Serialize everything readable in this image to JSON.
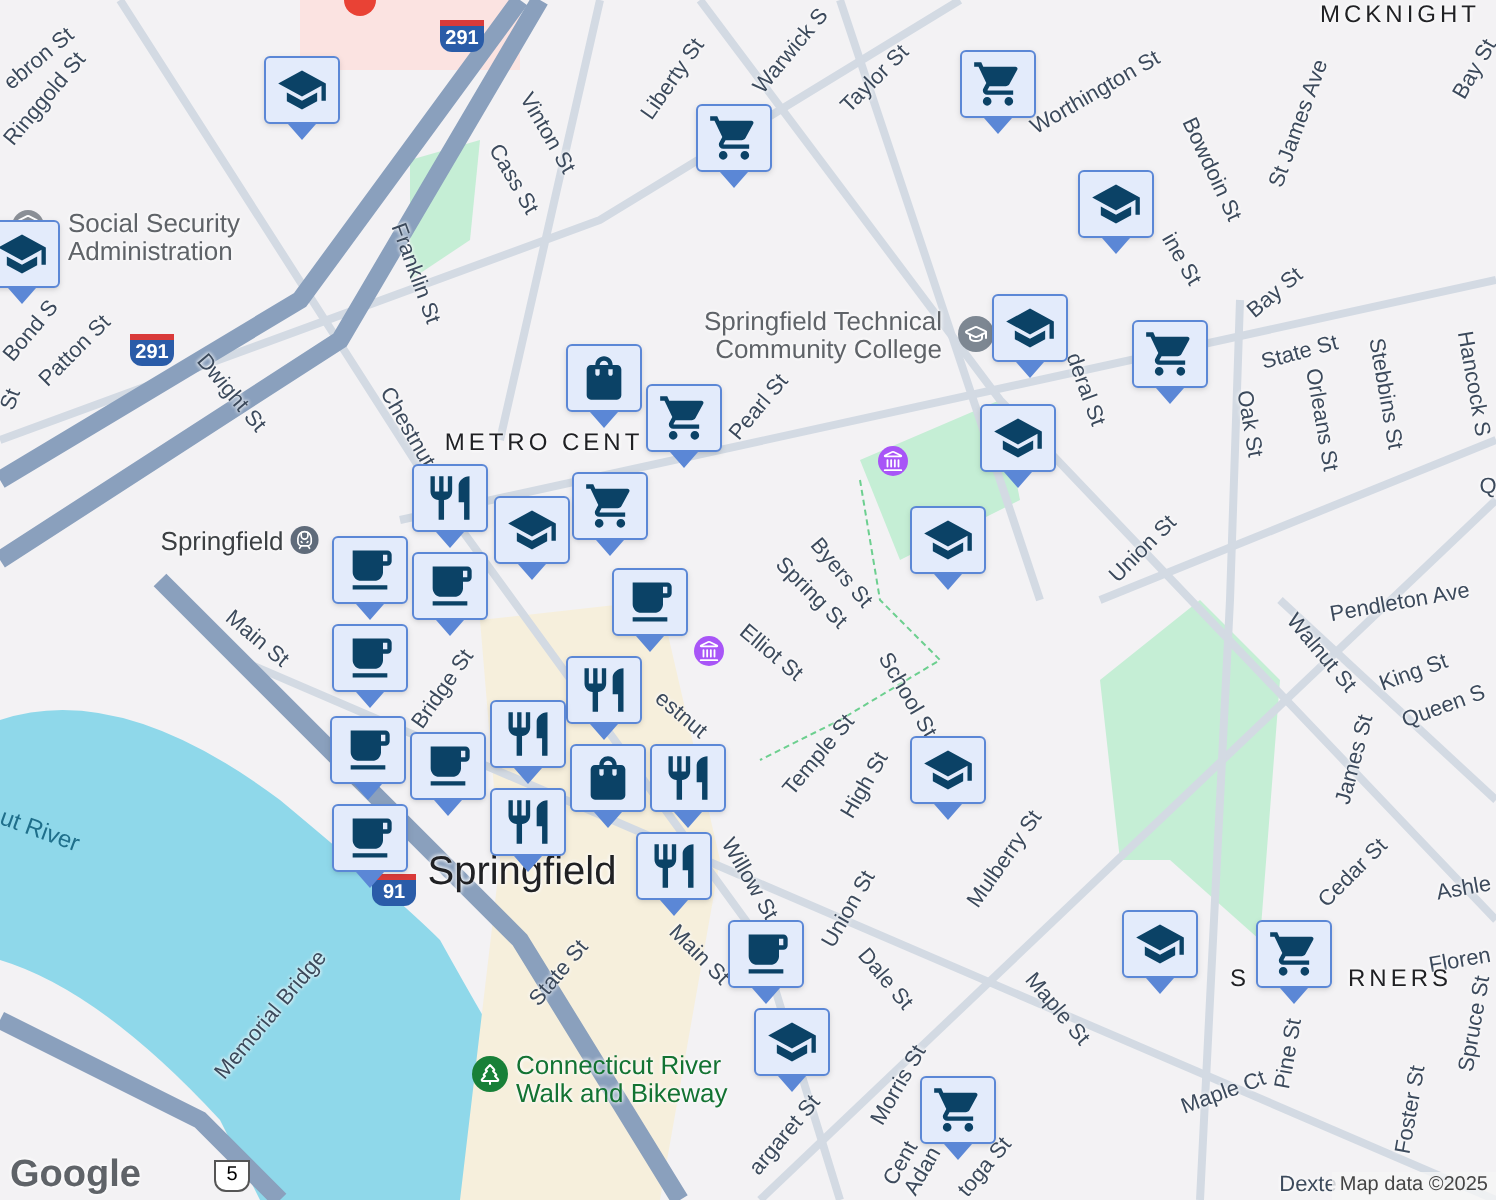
{
  "map": {
    "labels": [
      {
        "text": "ebron St",
        "kind": "street"
      },
      {
        "text": "Ringgold St",
        "kind": "street"
      },
      {
        "text": "Vinton St",
        "kind": "street"
      },
      {
        "text": "Cass St",
        "kind": "street"
      },
      {
        "text": "Franklin St",
        "kind": "street"
      },
      {
        "text": "Liberty St",
        "kind": "street"
      },
      {
        "text": "Social Security Administration",
        "kind": "poi"
      },
      {
        "text": "Bond S",
        "kind": "street"
      },
      {
        "text": "Patton St",
        "kind": "street"
      },
      {
        "text": "St",
        "kind": "street"
      },
      {
        "text": "Dwight St",
        "kind": "street"
      },
      {
        "text": "Chestnut",
        "kind": "street"
      },
      {
        "text": "METRO CENT",
        "kind": "district"
      },
      {
        "text": "Springfield",
        "kind": "transit"
      },
      {
        "text": "Warwick S",
        "kind": "street"
      },
      {
        "text": "Taylor St",
        "kind": "street"
      },
      {
        "text": "Worthington St",
        "kind": "street"
      },
      {
        "text": "Bowdoin St",
        "kind": "street"
      },
      {
        "text": "St James Ave",
        "kind": "street"
      },
      {
        "text": "MCKNIGHT",
        "kind": "district"
      },
      {
        "text": "Bay St",
        "kind": "street"
      },
      {
        "text": "Bay St",
        "kind": "street"
      },
      {
        "text": "ine St",
        "kind": "street"
      },
      {
        "text": "Springfield Technical Community College",
        "kind": "poi"
      },
      {
        "text": "Pearl St",
        "kind": "street"
      },
      {
        "text": "deral St",
        "kind": "street"
      },
      {
        "text": "State St",
        "kind": "street"
      },
      {
        "text": "Oak St",
        "kind": "street"
      },
      {
        "text": "Orleans St",
        "kind": "street"
      },
      {
        "text": "Stebbins St",
        "kind": "street"
      },
      {
        "text": "Hancock S",
        "kind": "street"
      },
      {
        "text": "Q",
        "kind": "street"
      },
      {
        "text": "Byers St",
        "kind": "street"
      },
      {
        "text": "Spring St",
        "kind": "street"
      },
      {
        "text": "Union St",
        "kind": "street"
      },
      {
        "text": "Pendleton Ave",
        "kind": "street"
      },
      {
        "text": "Walnut St",
        "kind": "street"
      },
      {
        "text": "King St",
        "kind": "street"
      },
      {
        "text": "Queen S",
        "kind": "street"
      },
      {
        "text": "Elliot St",
        "kind": "street"
      },
      {
        "text": "School St",
        "kind": "street"
      },
      {
        "text": "Temple St",
        "kind": "street"
      },
      {
        "text": "High St",
        "kind": "street"
      },
      {
        "text": "Mulberry St",
        "kind": "street"
      },
      {
        "text": "James St",
        "kind": "street"
      },
      {
        "text": "Cedar St",
        "kind": "street"
      },
      {
        "text": "Ashle",
        "kind": "street"
      },
      {
        "text": "Floren",
        "kind": "street"
      },
      {
        "text": "S",
        "kind": "district"
      },
      {
        "text": "RNERS",
        "kind": "district"
      },
      {
        "text": "Spruce St",
        "kind": "street"
      },
      {
        "text": "Pine St",
        "kind": "street"
      },
      {
        "text": "Foster St",
        "kind": "street"
      },
      {
        "text": "Maple Ct",
        "kind": "street"
      },
      {
        "text": "Maple St",
        "kind": "street"
      },
      {
        "text": "Dale St",
        "kind": "street"
      },
      {
        "text": "Union St",
        "kind": "street"
      },
      {
        "text": "Willow St",
        "kind": "street"
      },
      {
        "text": "Morris St",
        "kind": "street"
      },
      {
        "text": "Cent",
        "kind": "street"
      },
      {
        "text": "Adan",
        "kind": "street"
      },
      {
        "text": "toga St",
        "kind": "street"
      },
      {
        "text": "Dexte",
        "kind": "street"
      },
      {
        "text": "argaret St",
        "kind": "street"
      },
      {
        "text": "Main St",
        "kind": "street"
      },
      {
        "text": "Bridge St",
        "kind": "street"
      },
      {
        "text": "estnut",
        "kind": "street"
      },
      {
        "text": "Main St",
        "kind": "street"
      },
      {
        "text": "State St",
        "kind": "street"
      },
      {
        "text": "Springfield",
        "kind": "city"
      },
      {
        "text": "ut River",
        "kind": "water"
      },
      {
        "text": "Memorial Bridge",
        "kind": "street"
      },
      {
        "text": "Connecticut River Walk and Bikeway",
        "kind": "park"
      }
    ],
    "shields": [
      {
        "text": "291",
        "kind": "interstate"
      },
      {
        "text": "291",
        "kind": "interstate"
      },
      {
        "text": "91",
        "kind": "interstate"
      },
      {
        "text": "5",
        "kind": "us"
      }
    ],
    "markers": [
      {
        "kind": "school"
      },
      {
        "kind": "cart"
      },
      {
        "kind": "school"
      },
      {
        "kind": "cart"
      },
      {
        "kind": "school"
      },
      {
        "kind": "school"
      },
      {
        "kind": "cart"
      },
      {
        "kind": "bag"
      },
      {
        "kind": "cart"
      },
      {
        "kind": "school"
      },
      {
        "kind": "school"
      },
      {
        "kind": "restaurant"
      },
      {
        "kind": "cart"
      },
      {
        "kind": "school"
      },
      {
        "kind": "coffee"
      },
      {
        "kind": "coffee"
      },
      {
        "kind": "coffee"
      },
      {
        "kind": "coffee"
      },
      {
        "kind": "coffee"
      },
      {
        "kind": "restaurant"
      },
      {
        "kind": "restaurant"
      },
      {
        "kind": "restaurant"
      },
      {
        "kind": "coffee"
      },
      {
        "kind": "coffee"
      },
      {
        "kind": "restaurant"
      },
      {
        "kind": "bag"
      },
      {
        "kind": "restaurant"
      },
      {
        "kind": "school"
      },
      {
        "kind": "coffee"
      },
      {
        "kind": "school"
      },
      {
        "kind": "cart"
      },
      {
        "kind": "school"
      },
      {
        "kind": "cart"
      }
    ],
    "logo": "Google",
    "attribution": "Map data ©2025"
  }
}
